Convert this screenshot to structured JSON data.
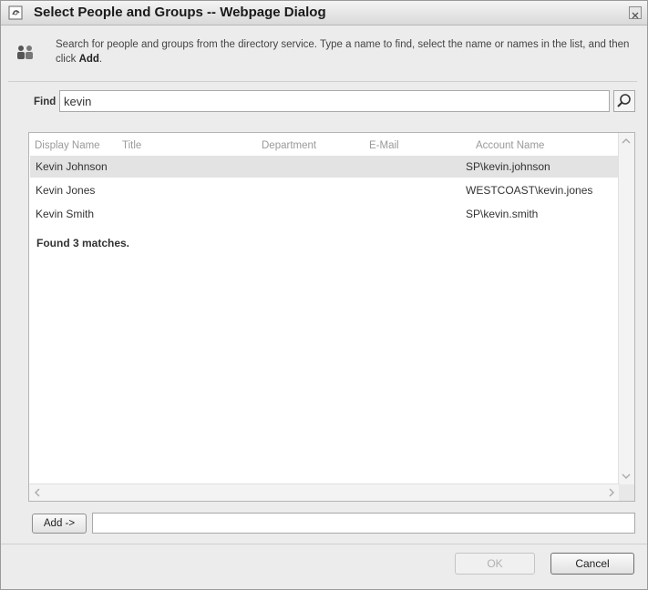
{
  "window": {
    "title": "Select People and Groups -- Webpage Dialog"
  },
  "header": {
    "instructions_main": "Search for people and groups from the directory service. Type a name to find, select the name or names in the list, and then click ",
    "instructions_bold": "Add",
    "instructions_end": "."
  },
  "find": {
    "label": "Find",
    "value": "kevin"
  },
  "results": {
    "columns": [
      "Display Name",
      "Title",
      "Department",
      "E-Mail",
      "Account Name"
    ],
    "rows": [
      {
        "display_name": "Kevin Johnson",
        "title": "",
        "department": "",
        "email": "",
        "account": "SP\\kevin.johnson",
        "selected": true
      },
      {
        "display_name": "Kevin Jones",
        "title": "",
        "department": "",
        "email": "",
        "account": "WESTCOAST\\kevin.jones",
        "selected": false
      },
      {
        "display_name": "Kevin Smith",
        "title": "",
        "department": "",
        "email": "",
        "account": "SP\\kevin.smith",
        "selected": false
      }
    ],
    "status": "Found 3 matches."
  },
  "add": {
    "label": "Add ->",
    "selected_value": ""
  },
  "footer": {
    "ok_label": "OK",
    "cancel_label": "Cancel"
  },
  "icons": {
    "title_icon": "ie-page-icon",
    "people_icon": "people-icon",
    "search_icon": "magnifier-icon",
    "close_icon": "close-icon"
  }
}
